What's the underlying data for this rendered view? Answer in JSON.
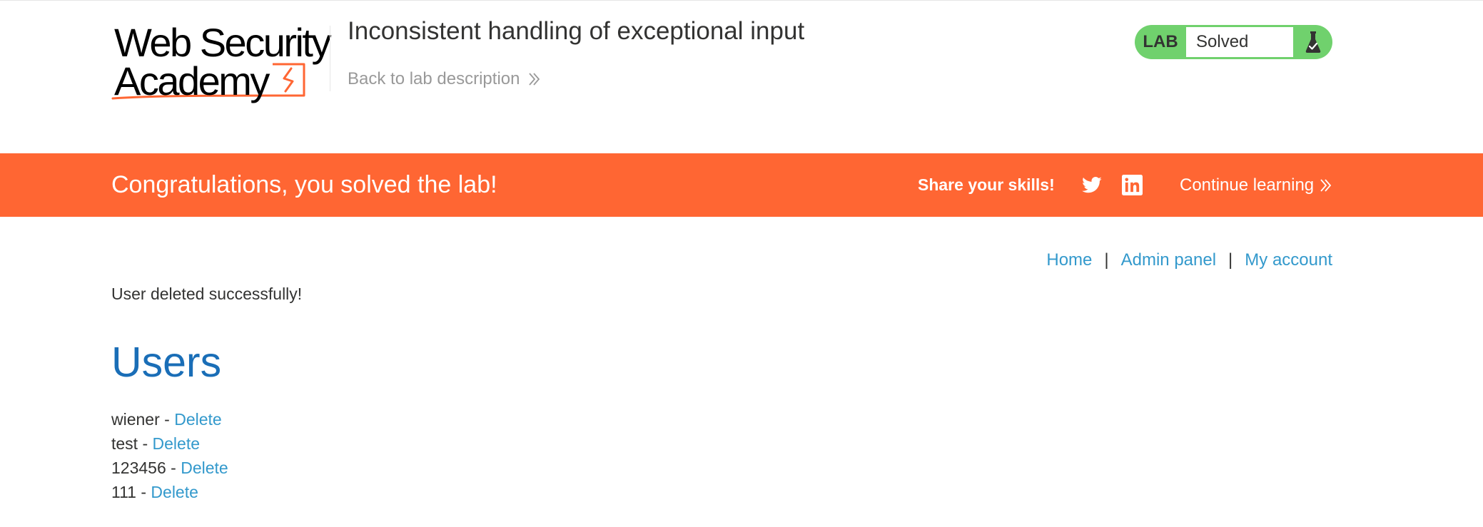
{
  "header": {
    "logo": {
      "line1": "Web Security",
      "line2": "Academy"
    },
    "lab_title": "Inconsistent handling of exceptional input",
    "back_link": "Back to lab description",
    "status": {
      "badge": "LAB",
      "state": "Solved",
      "icon": "flask-icon"
    }
  },
  "banner": {
    "message": "Congratulations, you solved the lab!",
    "share_label": "Share your skills!",
    "social_icons": [
      "twitter-icon",
      "linkedin-icon"
    ],
    "continue_label": "Continue learning"
  },
  "nav": {
    "items": [
      "Home",
      "Admin panel",
      "My account"
    ],
    "separator": "|"
  },
  "main": {
    "flash": "User deleted successfully!",
    "heading": "Users",
    "users": [
      {
        "name": "wiener",
        "sep": " - ",
        "action": "Delete"
      },
      {
        "name": "test",
        "sep": " - ",
        "action": "Delete"
      },
      {
        "name": "123456",
        "sep": " - ",
        "action": "Delete"
      },
      {
        "name": "111",
        "sep": " - ",
        "action": "Delete"
      }
    ]
  },
  "colors": {
    "accent": "#ff6633",
    "status_green": "#70d16d",
    "link": "#3399cc",
    "heading": "#1a6eb7",
    "text": "#333332"
  }
}
